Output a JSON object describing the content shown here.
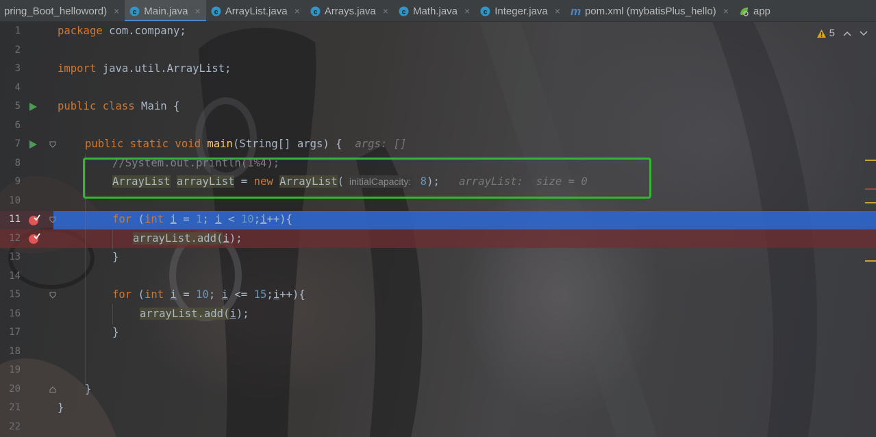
{
  "tabs": [
    {
      "label": "pring_Boot_helloword)",
      "icon": "none",
      "active": false
    },
    {
      "label": "Main.java",
      "icon": "java-class-icon",
      "active": true
    },
    {
      "label": "ArrayList.java",
      "icon": "java-class-icon",
      "active": false
    },
    {
      "label": "Arrays.java",
      "icon": "java-class-icon",
      "active": false
    },
    {
      "label": "Math.java",
      "icon": "java-class-icon",
      "active": false
    },
    {
      "label": "Integer.java",
      "icon": "java-class-icon",
      "active": false
    },
    {
      "label": "pom.xml (mybatisPlus_hello)",
      "icon": "maven-icon",
      "active": false
    },
    {
      "label": "app",
      "icon": "spring-icon",
      "active": false
    }
  ],
  "tab_close_glyph": "×",
  "warnings": {
    "count": "5"
  },
  "line_numbers": [
    "1",
    "2",
    "3",
    "4",
    "5",
    "6",
    "7",
    "8",
    "9",
    "10",
    "11",
    "12",
    "13",
    "14",
    "15",
    "16",
    "17",
    "18",
    "19",
    "20",
    "21",
    "22"
  ],
  "current_line": "11",
  "breakpoint_lines": [
    "11",
    "12"
  ],
  "code": {
    "l1_kw": "package",
    "l1_rest": " com.company;",
    "l3_kw": "import",
    "l3_rest": " java.util.ArrayList;",
    "l5_kw": "public class",
    "l5_rest": " Main {",
    "l7_kw": "public static void",
    "l7_fn": "main",
    "l7_rest": "(String[] args) {",
    "l7_hint": "args: []",
    "l8_comment": "//System.out.println(1%4);",
    "l9_type": "ArrayList",
    "l9_var": "arrayList",
    "l9_eq": " = ",
    "l9_new": "new",
    "l9_ctor": "ArrayList",
    "l9_paren": "(",
    "l9_param": "initialCapacity:",
    "l9_num": "8",
    "l9_end": ");",
    "l9_hint": "arrayList:  size = 0",
    "l11_for": "for",
    "l11_a": " (",
    "l11_int": "int",
    "l11_i": "i",
    "l11_b": " = ",
    "l11_one": "1",
    "l11_c": "; ",
    "l11_i2": "i",
    "l11_d": " < ",
    "l11_ten": "10",
    "l11_e": ";",
    "l11_i3": "i",
    "l11_f": "++){",
    "l12_call": "arrayList.add(",
    "l12_i": "i",
    "l12_end": ");",
    "l13": "}",
    "l15_for": "for",
    "l15_a": " (",
    "l15_int": "int",
    "l15_i": "i",
    "l15_b": " = ",
    "l15_ten": "10",
    "l15_c": "; ",
    "l15_i2": "i",
    "l15_d": " <= ",
    "l15_fifteen": "15",
    "l15_e": ";",
    "l15_i3": "i",
    "l15_f": "++){",
    "l16_call": "arrayList.add(",
    "l16_i": "i",
    "l16_end": ");",
    "l17": "}",
    "l20": "}",
    "l21": "}"
  },
  "colors": {
    "keyword": "#cc7832",
    "number": "#6897bb",
    "method": "#ffc66d",
    "comment": "#808080",
    "text": "#a9b7c6",
    "current_line": "#2f65ca",
    "breakpoint": "#e05555",
    "highlight_box": "#35b534",
    "run_icon": "#499c54"
  }
}
